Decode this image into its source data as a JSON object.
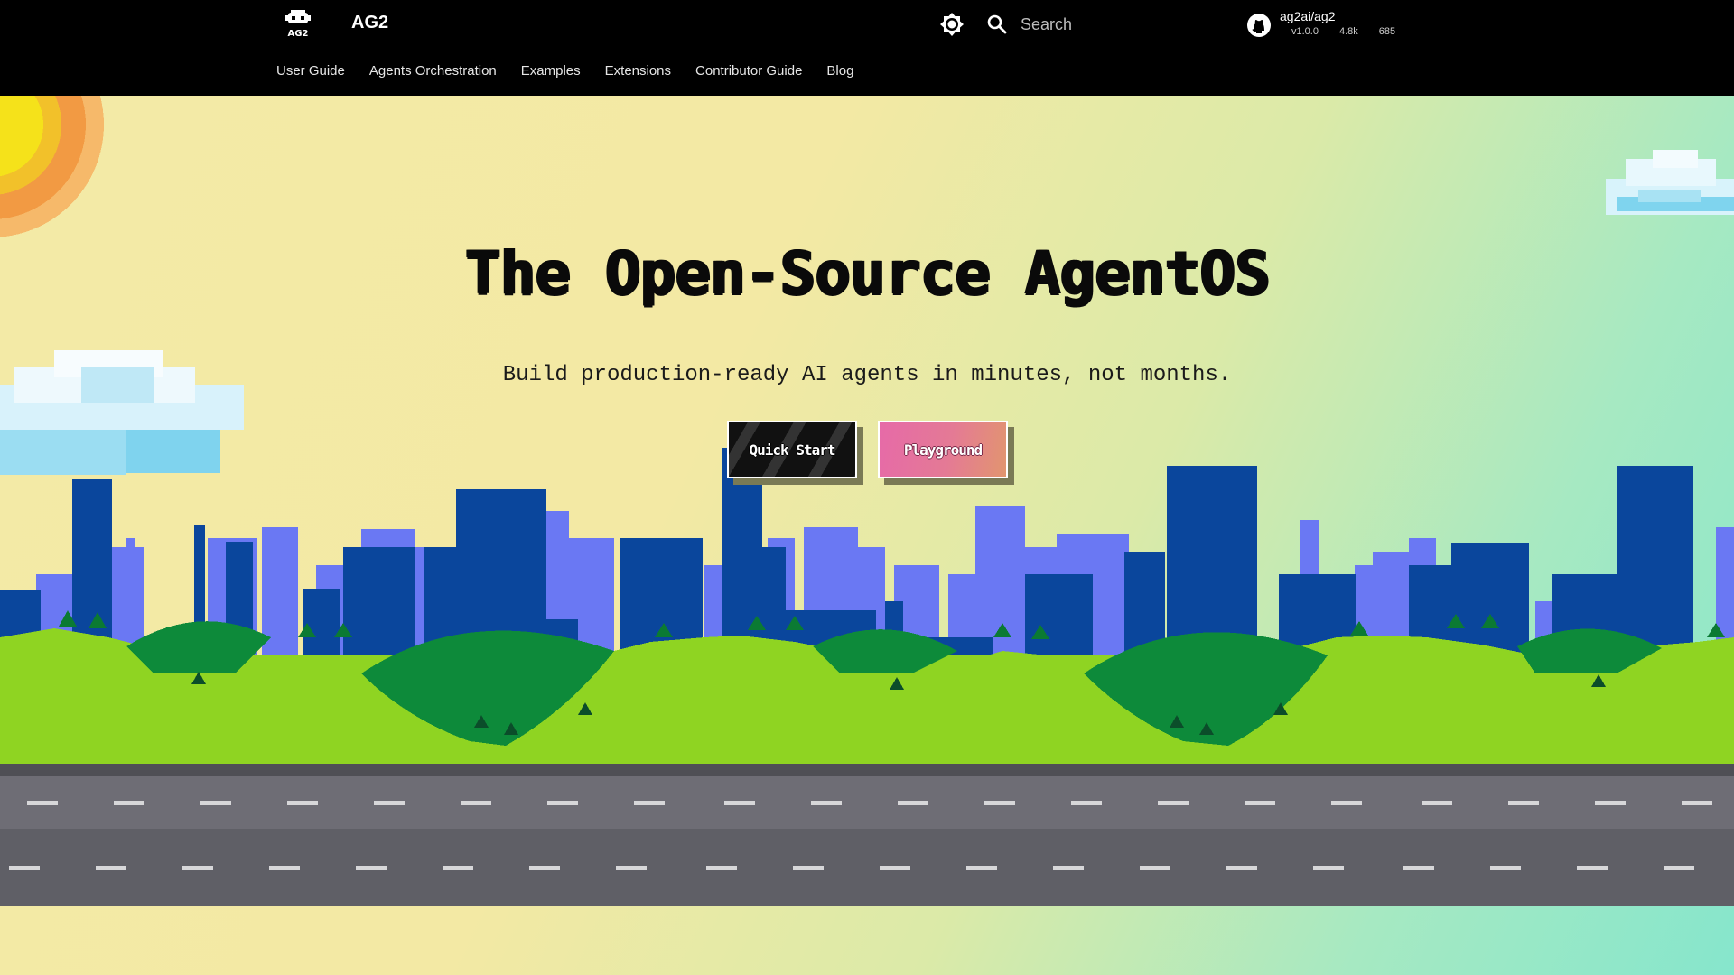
{
  "header": {
    "brand": "AG2",
    "search_label": "Search",
    "repo": {
      "name": "ag2ai/ag2",
      "version": "v1.0.0",
      "stars": "4.8k",
      "forks": "685"
    },
    "nav": [
      "User Guide",
      "Agents Orchestration",
      "Examples",
      "Extensions",
      "Contributor Guide",
      "Blog"
    ]
  },
  "hero": {
    "title": "The Open-Source AgentOS",
    "subtitle": "Build production-ready AI agents in minutes, not months.",
    "buttons": {
      "quick_start": "Quick Start",
      "playground": "Playground"
    }
  },
  "icons": {
    "logo": "ag2-robot-logo",
    "theme": "sun-brightness-icon",
    "search": "search-icon",
    "repo": "github-icon"
  },
  "colors": {
    "header_bg": "#000000",
    "sky_left": "#f3eaa6",
    "sky_right": "#86e6cc",
    "building_dark": "#0a469c",
    "building_light": "#6a78f3",
    "grass": "#8fd422",
    "hill": "#0d8a3a",
    "road": "#5f5f66"
  }
}
